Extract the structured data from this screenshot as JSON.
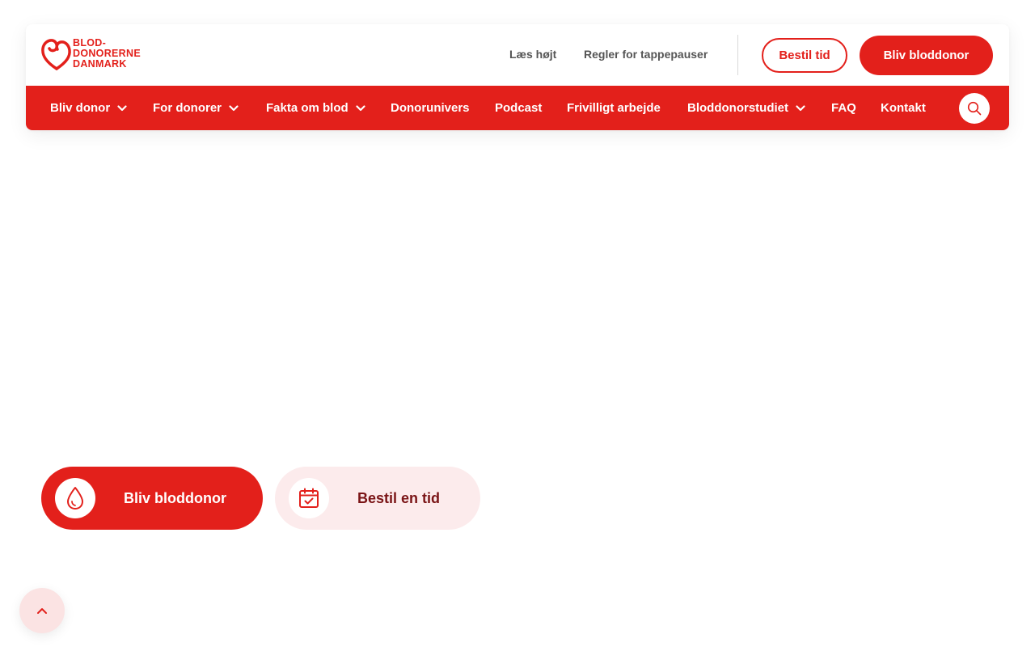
{
  "brand": {
    "logo_text": "BLOD-\nDONORERNE\nDANMARK",
    "accent_color": "#e3201b",
    "light_accent": "#fcebec"
  },
  "utility": {
    "read_aloud": "Læs højt",
    "donation_breaks": "Regler for tappepauser",
    "book_time": "Bestil tid",
    "become_donor": "Bliv bloddonor"
  },
  "nav": {
    "items": [
      {
        "label": "Bliv donor",
        "dropdown": true
      },
      {
        "label": "For donorer",
        "dropdown": true
      },
      {
        "label": "Fakta om blod",
        "dropdown": true
      },
      {
        "label": "Donorunivers",
        "dropdown": false
      },
      {
        "label": "Podcast",
        "dropdown": false
      },
      {
        "label": "Frivilligt arbejde",
        "dropdown": false
      },
      {
        "label": "Bloddonorstudiet",
        "dropdown": true
      },
      {
        "label": "FAQ",
        "dropdown": false
      },
      {
        "label": "Kontakt",
        "dropdown": false
      }
    ],
    "search_icon": "search-icon"
  },
  "hero": {
    "cta_primary": {
      "label": "Bliv bloddonor",
      "icon": "blood-drop-icon"
    },
    "cta_secondary": {
      "label": "Bestil en tid",
      "icon": "calendar-check-icon"
    }
  },
  "scroll_top_icon": "chevron-up-icon"
}
